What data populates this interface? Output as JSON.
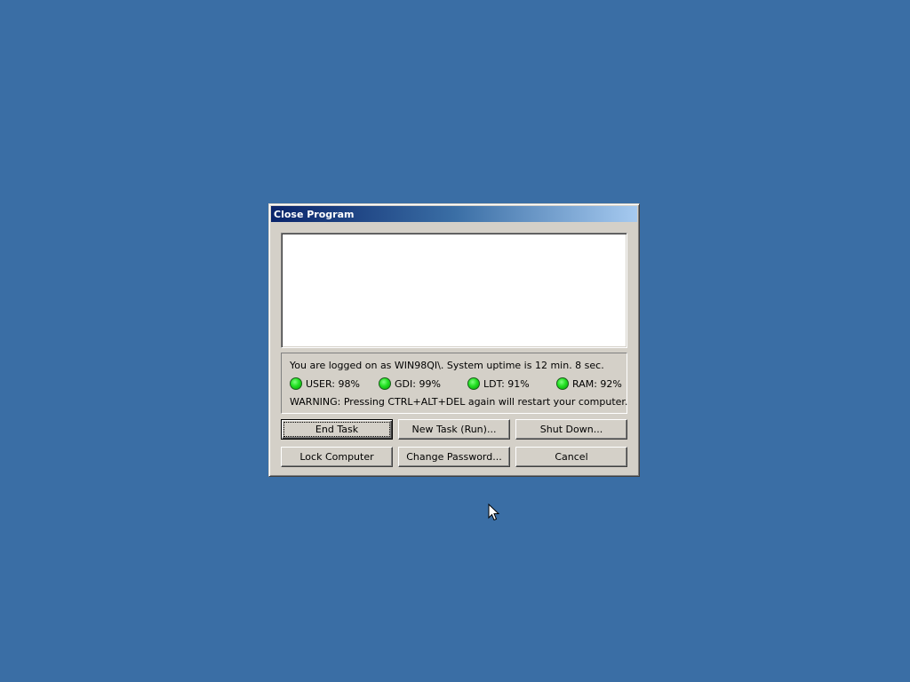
{
  "dialog": {
    "title": "Close Program",
    "info": {
      "logon_text": "You are logged on as WIN98QI\\. System uptime is 12 min. 8 sec.",
      "warning_text": "WARNING: Pressing CTRL+ALT+DEL again will restart your computer.",
      "resources": [
        {
          "label": "USER: 98%",
          "name": "USER",
          "percent": 98,
          "status_color": "#22e022"
        },
        {
          "label": "GDI: 99%",
          "name": "GDI",
          "percent": 99,
          "status_color": "#22e022"
        },
        {
          "label": "LDT: 91%",
          "name": "LDT",
          "percent": 91,
          "status_color": "#22e022"
        },
        {
          "label": "RAM: 92%",
          "name": "RAM",
          "percent": 92,
          "status_color": "#22e022"
        }
      ]
    },
    "buttons": {
      "end_task": "End Task",
      "new_task": "New Task (Run)...",
      "shut_down": "Shut Down...",
      "lock_computer": "Lock Computer",
      "change_password": "Change Password...",
      "cancel": "Cancel"
    },
    "task_list": []
  },
  "colors": {
    "desktop": "#3a6ea5",
    "titlebar_start": "#0a246a",
    "titlebar_end": "#a6caf0",
    "dialog_face": "#d4d0c8"
  },
  "icons": {
    "cursor": "arrow-cursor-icon",
    "resource_status": "green-led-icon"
  }
}
